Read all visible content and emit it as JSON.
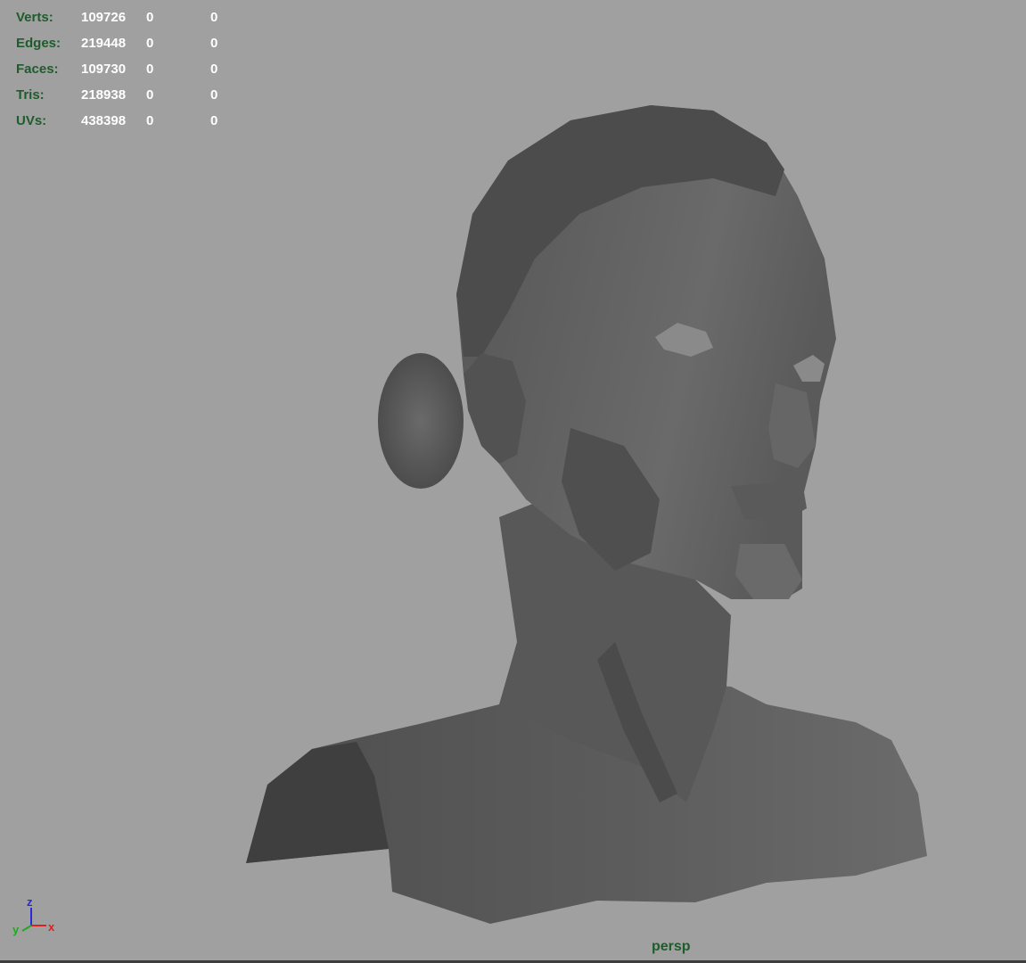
{
  "viewport": {
    "camera": "persp",
    "background_color": "#a0a0a0",
    "mesh_color": "#5a5a5a"
  },
  "hud": {
    "rows": [
      {
        "label": "Verts:",
        "count": "109726",
        "selected": "0",
        "uv": "0"
      },
      {
        "label": "Edges:",
        "count": "219448",
        "selected": "0",
        "uv": "0"
      },
      {
        "label": "Faces:",
        "count": "109730",
        "selected": "0",
        "uv": "0"
      },
      {
        "label": "Tris:",
        "count": "218938",
        "selected": "0",
        "uv": "0"
      },
      {
        "label": "UVs:",
        "count": "438398",
        "selected": "0",
        "uv": "0"
      }
    ]
  },
  "axis_gizmo": {
    "z_label": "z",
    "y_label": "y",
    "x_label": "x",
    "z_color": "#2a2ad8",
    "y_color": "#1faa1f",
    "x_color": "#e02020"
  }
}
